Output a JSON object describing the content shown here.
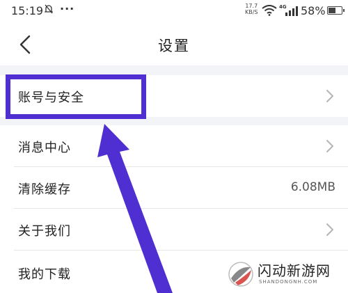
{
  "status_bar": {
    "time": "15:19",
    "net_speed_value": "17.7",
    "net_speed_unit": "KB/S",
    "network_type": "4G",
    "battery_percent": "58%",
    "battery_level": 0.58
  },
  "header": {
    "title": "设置",
    "back_icon": "chevron-left-icon"
  },
  "settings": {
    "items": [
      {
        "label": "账号与安全",
        "value": "",
        "icon": "chevron-right-icon"
      },
      {
        "label": "消息中心",
        "value": "",
        "icon": "chevron-right-icon"
      },
      {
        "label": "清除缓存",
        "value": "6.08MB"
      },
      {
        "label": "关于我们",
        "value": "",
        "icon": "chevron-right-icon"
      },
      {
        "label": "我的下载",
        "value": ""
      }
    ]
  },
  "annotation": {
    "color": "#4f2fd1"
  },
  "watermark": {
    "text": "闪动新游网",
    "subtext": "SHANDONGNH.COM"
  }
}
